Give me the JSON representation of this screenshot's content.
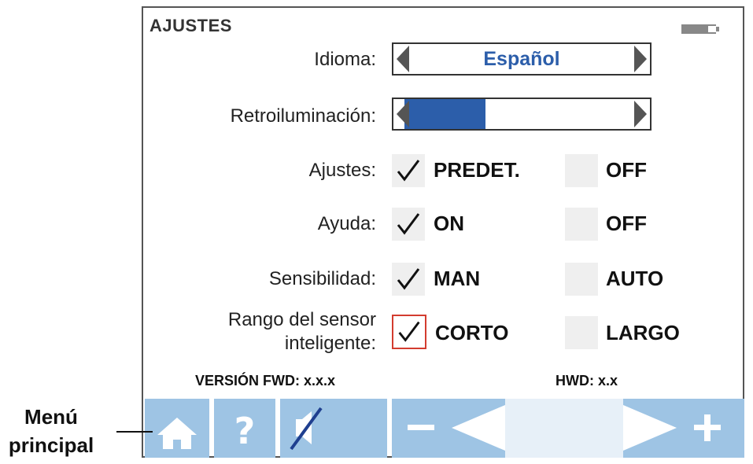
{
  "screen": {
    "title": "AJUSTES",
    "battery_icon": "battery-icon",
    "language": {
      "label": "Idioma:",
      "value": "Español",
      "accent": "#2c5eaa"
    },
    "backlight": {
      "label": "Retroiluminación:",
      "level": 0.38
    },
    "settings_rows": [
      {
        "label": "Ajustes:",
        "option_a": "PREDET.",
        "option_b": "OFF",
        "checked": "a"
      },
      {
        "label": "Ayuda:",
        "option_a": "ON",
        "option_b": "OFF",
        "checked": "a"
      },
      {
        "label": "Sensibilidad:",
        "option_a": "MAN",
        "option_b": "AUTO",
        "checked": "a"
      },
      {
        "label_line1": "Rango del sensor",
        "label_line2": "inteligente:",
        "option_a": "CORTO",
        "option_b": "LARGO",
        "checked": "a",
        "focused": true
      }
    ],
    "version": {
      "fwd_label": "VERSIÓN FWD:",
      "fwd_value": "x.x.x",
      "hwd_label": "HWD:",
      "hwd_value": "x.x"
    },
    "toolbar": {
      "buttons": [
        "home-icon",
        "help-icon",
        "mute-icon",
        "minus-icon",
        "left-arrow-icon",
        "right-arrow-icon",
        "plus-icon"
      ],
      "help_glyph": "?",
      "color": "#9ec4e4"
    }
  },
  "callout": {
    "line1": "Menú",
    "line2": "principal"
  }
}
